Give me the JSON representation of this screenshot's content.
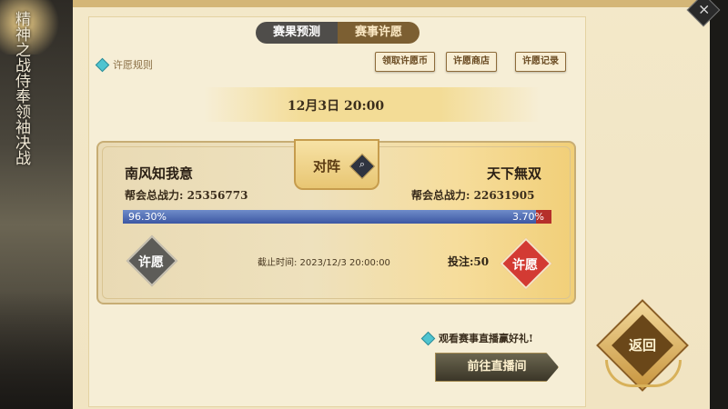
{
  "side_banner": "精神之战侍奉领袖决战",
  "tabs": [
    {
      "label": "赛果预测",
      "active": false
    },
    {
      "label": "赛事许愿",
      "active": true
    }
  ],
  "rules_link": "许愿规则",
  "header_buttons": [
    "领取许愿币",
    "许愿商店",
    "许愿记录"
  ],
  "match_time": "12月3日  20:00",
  "matchup": {
    "vs_label": "对阵",
    "left_team": {
      "name": "南风知我意",
      "power_label": "帮会总战力:",
      "power": "25356773",
      "percent_text": "96.30%",
      "percent_value": 96.3
    },
    "right_team": {
      "name": "天下無双",
      "power_label": "帮会总战力:",
      "power": "22631905",
      "percent_text": "3.70%",
      "percent_value": 3.7
    },
    "deadline": "截止时间: 2023/12/3  20:00:00",
    "bet": "投注:50",
    "wish_label": "许愿"
  },
  "watch_text": "观看赛事直播赢好礼!",
  "goto_live_label": "前往直播间",
  "return_label": "返回",
  "close_label": "×",
  "colors": {
    "blue_bar": "#3c57a3",
    "red_bar": "#b52f2a",
    "gold": "#c69c4d"
  }
}
